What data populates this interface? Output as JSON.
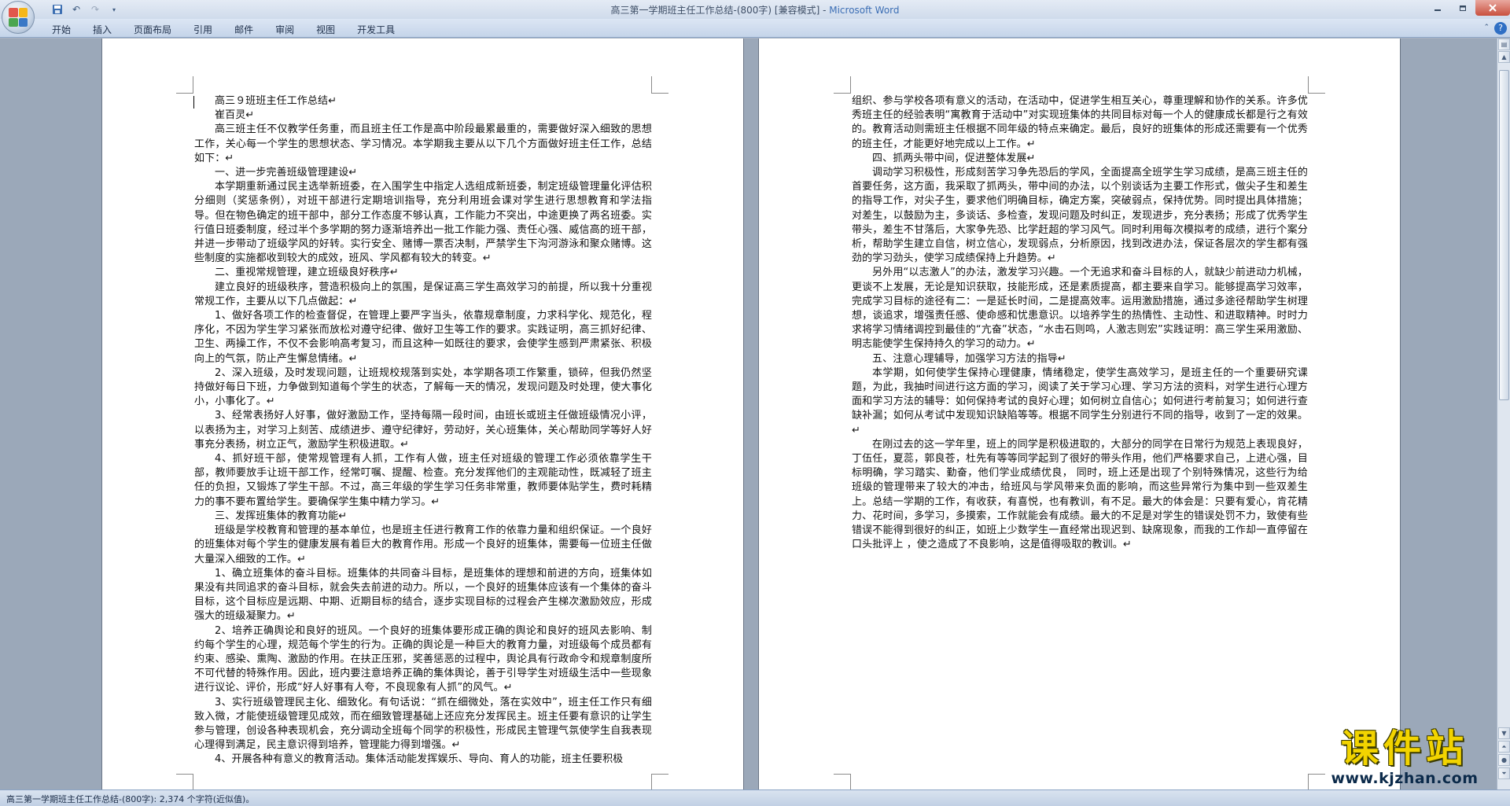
{
  "window": {
    "title": "高三第一学期班主任工作总结-(800字) [兼容模式] - ",
    "app_name": "Microsoft Word"
  },
  "qat": {
    "save_icon": "save-icon",
    "undo_icon": "undo-icon",
    "redo_icon": "redo-icon"
  },
  "ribbon": {
    "tabs": [
      "开始",
      "插入",
      "页面布局",
      "引用",
      "邮件",
      "审阅",
      "视图",
      "开发工具"
    ]
  },
  "status": {
    "text": "高三第一学期班主任工作总结-(800字): 2,374 个字符(近似值)。"
  },
  "watermark": {
    "logo_text": "课件站",
    "url": "www.kjzhan.com"
  },
  "page1": {
    "paragraphs": [
      "高三９班班主任工作总结↵",
      "崔百灵↵",
      "高三班主任不仅教学任务重，而且班主任工作是高中阶段最累最重的，需要做好深入细致的思想工作，关心每一个学生的思想状态、学习情况。本学期我主要从以下几个方面做好班主任工作，总结如下：↵",
      "一、进一步完善班级管理建设↵",
      "本学期重新通过民主选举新班委，在入围学生中指定人选组成新班委，制定班级管理量化评估积分细则（奖惩条例），对班干部进行定期培训指导，充分利用班会课对学生进行思想教育和学法指导。但在物色确定的班干部中，部分工作态度不够认真，工作能力不突出，中途更换了两名班委。实行值日班委制度，经过半个多学期的努力逐渐培养出一批工作能力强、责任心强、威信高的班干部，并进一步带动了班级学风的好转。实行安全、赌博一票否决制，严禁学生下沟河游泳和聚众赌博。这些制度的实施都收到较大的成效，班风、学风都有较大的转变。↵",
      "二、重视常规管理，建立班级良好秩序↵",
      "建立良好的班级秩序，营造积极向上的氛围，是保证高三学生高效学习的前提，所以我十分重视常规工作，主要从以下几点做起：↵",
      "1、做好各项工作的检查督促，在管理上要严字当头，依靠规章制度，力求科学化、规范化，程序化，不因为学生学习紧张而放松对遵守纪律、做好卫生等工作的要求。实践证明，高三抓好纪律、卫生、两操工作，不仅不会影响高考复习，而且这种一如既往的要求，会使学生感到严肃紧张、积极向上的气氛，防止产生懈怠情绪。↵",
      "2、深入班级，及时发现问题，让班规校规落到实处，本学期各项工作繁重，锁碎，但我仍然坚持做好每日下班，力争做到知道每个学生的状态，了解每一天的情况，发现问题及时处理，使大事化小，小事化了。↵",
      "3、经常表扬好人好事，做好激励工作，坚持每隔一段时间，由班长或班主任做班级情况小评，以表扬为主，对学习上刻苦、成绩进步、遵守纪律好，劳动好，关心班集体，关心帮助同学等好人好事充分表扬，树立正气，激励学生积极进取。↵",
      "4、抓好班干部，使常规管理有人抓，工作有人做，班主任对班级的管理工作必须依靠学生干部，教师要放手让班干部工作，经常叮嘱、提醒、检查。充分发挥他们的主观能动性，既减轻了班主任的负担，又锻炼了学生干部。不过，高三年级的学生学习任务非常重，教师要体贴学生，费时耗精力的事不要布置给学生。要确保学生集中精力学习。↵",
      "三、发挥班集体的教育功能↵",
      "班级是学校教育和管理的基本单位，也是班主任进行教育工作的依靠力量和组织保证。一个良好的班集体对每个学生的健康发展有着巨大的教育作用。形成一个良好的班集体，需要每一位班主任做大量深入细致的工作。↵",
      "1、确立班集体的奋斗目标。班集体的共同奋斗目标，是班集体的理想和前进的方向，班集体如果没有共同追求的奋斗目标，就会失去前进的动力。所以，一个良好的班集体应该有一个集体的奋斗目标，这个目标应是远期、中期、近期目标的结合，逐步实现目标的过程会产生梯次激励效应，形成强大的班级凝聚力。↵",
      "2、培养正确舆论和良好的班风。一个良好的班集体要形成正确的舆论和良好的班风去影响、制约每个学生的心理，规范每个学生的行为。正确的舆论是一种巨大的教育力量，对班级每个成员都有约束、感染、熏陶、激励的作用。在扶正压邪，奖善惩恶的过程中，舆论具有行政命令和规章制度所不可代替的特殊作用。因此，班内要注意培养正确的集体舆论，善于引导学生对班级生活中一些现象进行议论、评价，形成“好人好事有人夸，不良现象有人抓”的风气。↵",
      "3、实行班级管理民主化、细致化。有句话说：“抓在细微处，落在实效中”，班主任工作只有细致入微，才能使班级管理见成效，而在细致管理基础上还应充分发挥民主。班主任要有意识的让学生参与管理，创设各种表现机会，充分调动全班每个同学的积极性，形成民主管理气氛使学生自我表现心理得到满足，民主意识得到培养，管理能力得到增强。↵",
      "4、开展各种有意义的教育活动。集体活动能发挥娱乐、导向、育人的功能，班主任要积极"
    ]
  },
  "page2": {
    "paragraphs": [
      "组织、参与学校各项有意义的活动，在活动中，促进学生相互关心，尊重理解和协作的关系。许多优秀班主任的经验表明“寓教育于活动中”对实现班集体的共同目标对每一个人的健康成长都是行之有效的。教育活动则需班主任根据不同年级的特点来确定。最后，良好的班集体的形成还需要有一个优秀的班主任，才能更好地完成以上工作。↵",
      "四、抓两头带中间，促进整体发展↵",
      "调动学习积极性，形成刻苦学习争先恐后的学风，全面提高全班学生学习成绩，是高三班主任的首要任务，这方面，我采取了抓两头，带中间的办法，以个别谈话为主要工作形式，做尖子生和差生的指导工作，对尖子生，要求他们明确目标，确定方案，突破弱点，保持优势。同时提出具体措施；对差生，以鼓励为主，多谈话、多检查，发现问题及时纠正，发现进步，充分表扬；形成了优秀学生带头，差生不甘落后，大家争先恐、比学赶超的学习风气。同时利用每次模拟考的成绩，进行个案分析，帮助学生建立自信，树立信心，发现弱点，分析原因，找到改进办法，保证各层次的学生都有强劲的学习劲头，使学习成绩保持上升趋势。↵",
      "另外用“以志激人”的办法，激发学习兴趣。一个无追求和奋斗目标的人，就缺少前进动力机械，更谈不上发展，无论是知识获取，技能形成，还是素质提高，都主要来自学习。能够提高学习效率，完成学习目标的途径有二：一是延长时间，二是提高效率。运用激励措施，通过多途径帮助学生树理想，谈追求，增强责任感、使命感和忧患意识。以培养学生的热情性、主动性、和进取精神。时时力求将学习情绪调控到最佳的“亢奋”状态，“水击石则鸣，人激志则宏”实践证明：高三学生采用激励、明志能使学生保持持久的学习的动力。↵",
      "五、注意心理辅导，加强学习方法的指导↵",
      "本学期，如何使学生保持心理健康，情绪稳定，使学生高效学习，是班主任的一个重要研究课题，为此，我抽时间进行这方面的学习，阅读了关于学习心理、学习方法的资料，对学生进行心理方面和学习方法的辅导：如何保持考试的良好心理；如何树立自信心；如何进行考前复习；如何进行查缺补漏；如何从考试中发现知识缺陷等等。根据不同学生分别进行不同的指导，收到了一定的效果。↵",
      "在刚过去的这一学年里，班上的同学是积极进取的，大部分的同学在日常行为规范上表现良好，丁伍任，夏蕊，郭良苍，杜先有等等同学起到了很好的带头作用，他们严格要求自己，上进心强，目标明确，学习踏实、勤奋，他们学业成绩优良， 同时，班上还是出现了个别特殊情况，这些行为给班级的管理带来了较大的冲击，给班风与学风带来负面的影响，而这些异常行为集中到一些双差生上。总结一学期的工作，有收获，有喜悦，也有教训，有不足。最大的体会是：只要有爱心，肯花精力、花时间，多学习，多摸索，工作就能会有成绩。最大的不足是对学生的错误处罚不力，致使有些错误不能得到很好的纠正，如班上少数学生一直经常出现迟到、缺席现象，而我的工作却一直停留在口头批评上 ，使之造成了不良影响，这是值得吸取的教训。↵"
    ]
  },
  "colors": {
    "background": "#9ba8b9",
    "page": "#ffffff",
    "accent": "#3c6eb4",
    "watermark_yellow": "#f2d400"
  }
}
